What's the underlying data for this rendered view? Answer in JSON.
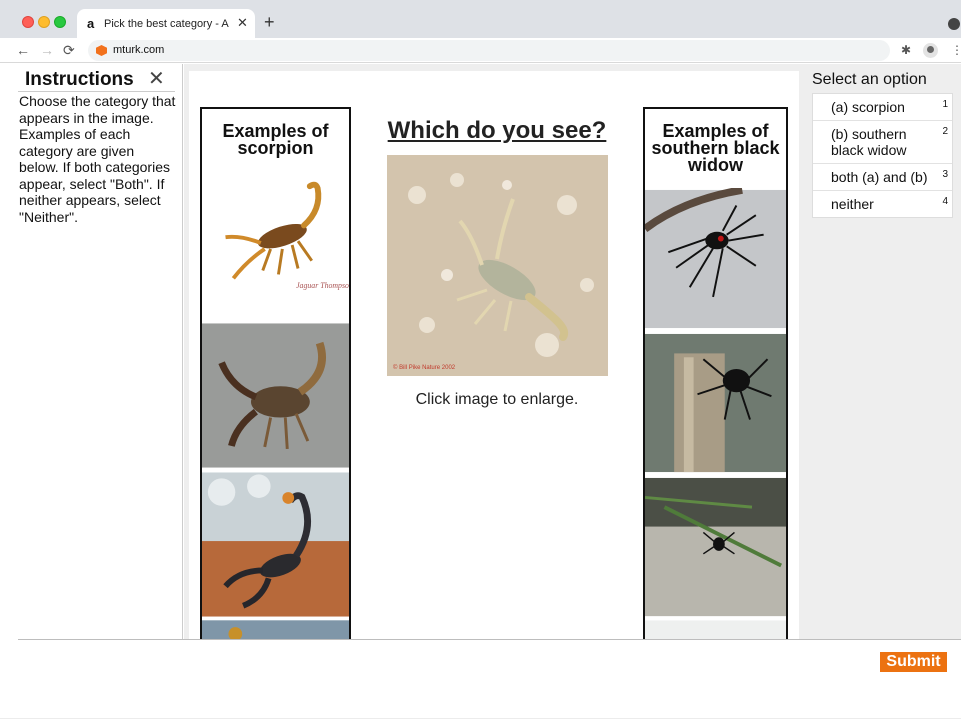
{
  "browser": {
    "tab_favicon": "a",
    "tab_title": "Pick the best category - Amazon",
    "tab_close": "✕",
    "new_tab": "+",
    "url": "mturk.com",
    "icons": [
      "back-arrow-icon",
      "forward-arrow-icon",
      "reload-icon",
      "extensions-puzzle-icon",
      "profile-avatar-icon",
      "kebab-menu-icon"
    ]
  },
  "instructions": {
    "title": "Instructions",
    "close": "✕",
    "body": "Choose the category that appears in the image. Examples of each category are given below. If both categories appear, select \"Both\". If neither appears, select \"Neither\"."
  },
  "task": {
    "question": "Which do you see?",
    "enlarge_hint": "Click image to enlarge.",
    "left_examples_title": "Examples of scorpion",
    "right_examples_title": "Examples of southern black widow"
  },
  "options": {
    "title": "Select an option",
    "items": [
      {
        "label": "(a) scorpion",
        "key": "1"
      },
      {
        "label": "(b) southern black widow",
        "key": "2"
      },
      {
        "label": "both (a) and (b)",
        "key": "3"
      },
      {
        "label": "neither",
        "key": "4"
      }
    ]
  },
  "footer": {
    "submit_label": "Submit"
  },
  "colors": {
    "accent": "#ec7211",
    "panel_bg": "#eeeeee"
  }
}
